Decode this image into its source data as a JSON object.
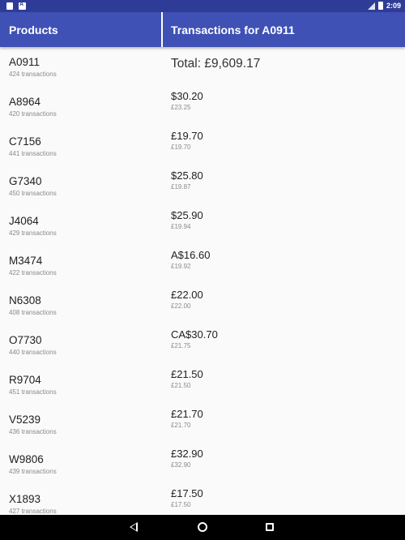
{
  "status_bar": {
    "time": "2:09"
  },
  "app_bar": {
    "products_title": "Products",
    "transactions_title": "Transactions for A0911"
  },
  "products": [
    {
      "name": "A0911",
      "count": "424 transactions"
    },
    {
      "name": "A8964",
      "count": "420 transactions"
    },
    {
      "name": "C7156",
      "count": "441 transactions"
    },
    {
      "name": "G7340",
      "count": "450 transactions"
    },
    {
      "name": "J4064",
      "count": "429 transactions"
    },
    {
      "name": "M3474",
      "count": "422 transactions"
    },
    {
      "name": "N6308",
      "count": "408 transactions"
    },
    {
      "name": "O7730",
      "count": "440 transactions"
    },
    {
      "name": "R9704",
      "count": "451 transactions"
    },
    {
      "name": "V5239",
      "count": "436 transactions"
    },
    {
      "name": "W9806",
      "count": "439 transactions"
    },
    {
      "name": "X1893",
      "count": "427 transactions"
    }
  ],
  "transactions": {
    "total": "Total: £9,609.17",
    "items": [
      {
        "amount": "$30.20",
        "gbp": "£23.25"
      },
      {
        "amount": "£19.70",
        "gbp": "£19.70"
      },
      {
        "amount": "$25.80",
        "gbp": "£19.87"
      },
      {
        "amount": "$25.90",
        "gbp": "£19.94"
      },
      {
        "amount": "A$16.60",
        "gbp": "£19.92"
      },
      {
        "amount": "£22.00",
        "gbp": "£22.00"
      },
      {
        "amount": "CA$30.70",
        "gbp": "£21.75"
      },
      {
        "amount": "£21.50",
        "gbp": "£21.50"
      },
      {
        "amount": "£21.70",
        "gbp": "£21.70"
      },
      {
        "amount": "£32.90",
        "gbp": "£32.90"
      },
      {
        "amount": "£17.50",
        "gbp": "£17.50"
      }
    ]
  },
  "icons": {
    "status_left": [
      "notification-icon",
      "app-notification-icon"
    ],
    "status_right": [
      "signal-icon",
      "battery-icon"
    ],
    "nav": [
      "back-icon",
      "home-icon",
      "recents-icon"
    ]
  },
  "colors": {
    "app_bar": "#3f51b5",
    "status_bar": "#2f3c97",
    "background": "#fafafa",
    "nav_bar": "#000000"
  }
}
